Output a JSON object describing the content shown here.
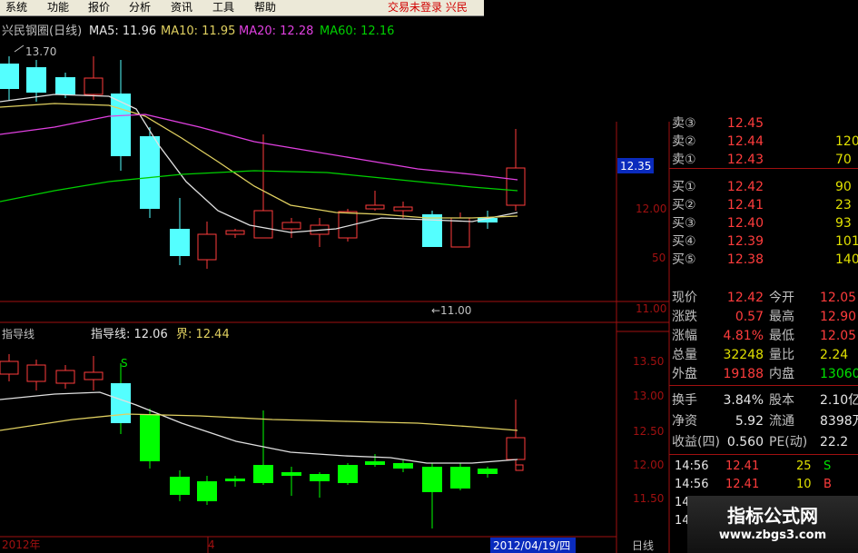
{
  "menu": {
    "items": [
      "系统",
      "功能",
      "报价",
      "分析",
      "资讯",
      "工具",
      "帮助"
    ],
    "login_status": "交易未登录",
    "brand_fragment": "兴民"
  },
  "upper_panel": {
    "stock_title": "兴民钢圈(日线)",
    "ma5_label": "MA5: 11.96",
    "ma10_label": "MA10: 11.95",
    "ma20_label": "MA20: 12.28",
    "ma60_label": "MA60: 12.16",
    "high_marker": "13.70",
    "low_marker": "←11.00",
    "price_ticks": [
      "12.00",
      "50",
      "11.00"
    ],
    "current_price": "12.35"
  },
  "lower_panel": {
    "indicator_name": "指导线",
    "guide_label": "指导线: 12.06",
    "boundary_label": "界: 12.44",
    "signal_marker": "S",
    "price_ticks": [
      "13.50",
      "13.00",
      "12.50",
      "12.00",
      "11.50"
    ]
  },
  "time_axis": {
    "year_label": "2012年",
    "month_label": "4",
    "date_label": "2012/04/19/四",
    "period_button": "日线"
  },
  "quote": {
    "ask_rows": [
      {
        "label": "卖③",
        "price": "12.45",
        "vol": ""
      },
      {
        "label": "卖②",
        "price": "12.44",
        "vol": "120"
      },
      {
        "label": "卖①",
        "price": "12.43",
        "vol": "70"
      }
    ],
    "bid_rows": [
      {
        "label": "买①",
        "price": "12.42",
        "vol": "90"
      },
      {
        "label": "买②",
        "price": "12.41",
        "vol": "23"
      },
      {
        "label": "买③",
        "price": "12.40",
        "vol": "93"
      },
      {
        "label": "买④",
        "price": "12.39",
        "vol": "101"
      },
      {
        "label": "买⑤",
        "price": "12.38",
        "vol": "140"
      }
    ],
    "stats_a": [
      {
        "l1": "现价",
        "v1": "12.42",
        "c1": "red",
        "l2": "今开",
        "v2": "12.05",
        "c2": "red"
      },
      {
        "l1": "涨跌",
        "v1": "0.57",
        "c1": "red",
        "l2": "最高",
        "v2": "12.90",
        "c2": "red"
      },
      {
        "l1": "涨幅",
        "v1": "4.81%",
        "c1": "red",
        "l2": "最低",
        "v2": "12.05",
        "c2": "red"
      },
      {
        "l1": "总量",
        "v1": "32248",
        "c1": "yellow",
        "l2": "量比",
        "v2": "2.24",
        "c2": "yellow"
      },
      {
        "l1": "外盘",
        "v1": "19188",
        "c1": "red",
        "l2": "内盘",
        "v2": "13060",
        "c2": "green"
      }
    ],
    "stats_b": [
      {
        "l1": "换手",
        "v1": "3.84%",
        "c1": "white",
        "l2": "股本",
        "v2": "2.10亿",
        "c2": "white"
      },
      {
        "l1": "净资",
        "v1": "5.92",
        "c1": "white",
        "l2": "流通",
        "v2": "8398万",
        "c2": "white"
      },
      {
        "l1": "收益(四)",
        "v1": "0.560",
        "c1": "white",
        "l2": "PE(动)",
        "v2": "22.2",
        "c2": "white"
      }
    ],
    "ticks": [
      {
        "time": "14:56",
        "price": "12.41",
        "vol": "25",
        "dir": "S",
        "dcolor": "green"
      },
      {
        "time": "14:56",
        "price": "12.41",
        "vol": "10",
        "dir": "B",
        "dcolor": "red"
      },
      {
        "time": "14:56",
        "price": "",
        "vol": "",
        "dir": "",
        "dcolor": "red"
      },
      {
        "time": "14:56",
        "price": "",
        "vol": "",
        "dir": "",
        "dcolor": "red"
      }
    ]
  },
  "watermark": {
    "title": "指标公式网",
    "url": "www.zbgs3.com"
  },
  "colors": {
    "up_candle": "#ff3c3c",
    "down_candle_upper": "#54ffff",
    "down_candle_lower": "#00ff00",
    "ma5": "#e0e0e0",
    "ma10": "#e0d060",
    "ma20": "#e040e0",
    "ma60": "#00d000"
  }
}
